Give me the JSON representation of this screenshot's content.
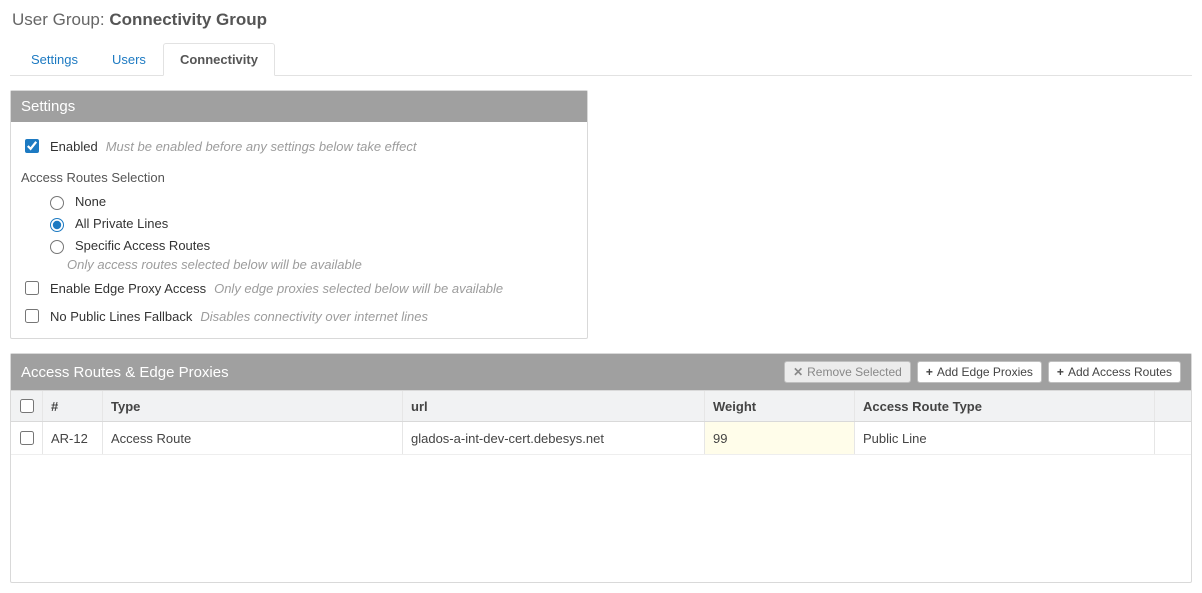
{
  "header": {
    "prefix": "User Group: ",
    "name": "Connectivity Group"
  },
  "tabs": [
    {
      "label": "Settings",
      "active": false
    },
    {
      "label": "Users",
      "active": false
    },
    {
      "label": "Connectivity",
      "active": true
    }
  ],
  "settingsPanel": {
    "title": "Settings",
    "enabled": {
      "label": "Enabled",
      "hint": "Must be enabled before any settings below take effect",
      "checked": true
    },
    "routesSelection": {
      "title": "Access Routes Selection",
      "options": {
        "none": "None",
        "all": "All Private Lines",
        "specific": "Specific Access Routes"
      },
      "selected": "all",
      "hint": "Only access routes selected below will be available"
    },
    "edgeProxy": {
      "label": "Enable Edge Proxy Access",
      "hint": "Only edge proxies selected below will be available",
      "checked": false
    },
    "noPublic": {
      "label": "No Public Lines Fallback",
      "hint": "Disables connectivity over internet lines",
      "checked": false
    }
  },
  "routesPanel": {
    "title": "Access Routes & Edge Proxies",
    "buttons": {
      "remove": "Remove Selected",
      "addEdge": "Add Edge Proxies",
      "addRoutes": "Add Access Routes"
    },
    "columns": {
      "id": "#",
      "type": "Type",
      "url": "url",
      "weight": "Weight",
      "art": "Access Route Type"
    },
    "rows": [
      {
        "id": "AR-12",
        "type": "Access Route",
        "url": "glados-a-int-dev-cert.debesys.net",
        "weight": "99",
        "art": "Public Line"
      }
    ]
  }
}
